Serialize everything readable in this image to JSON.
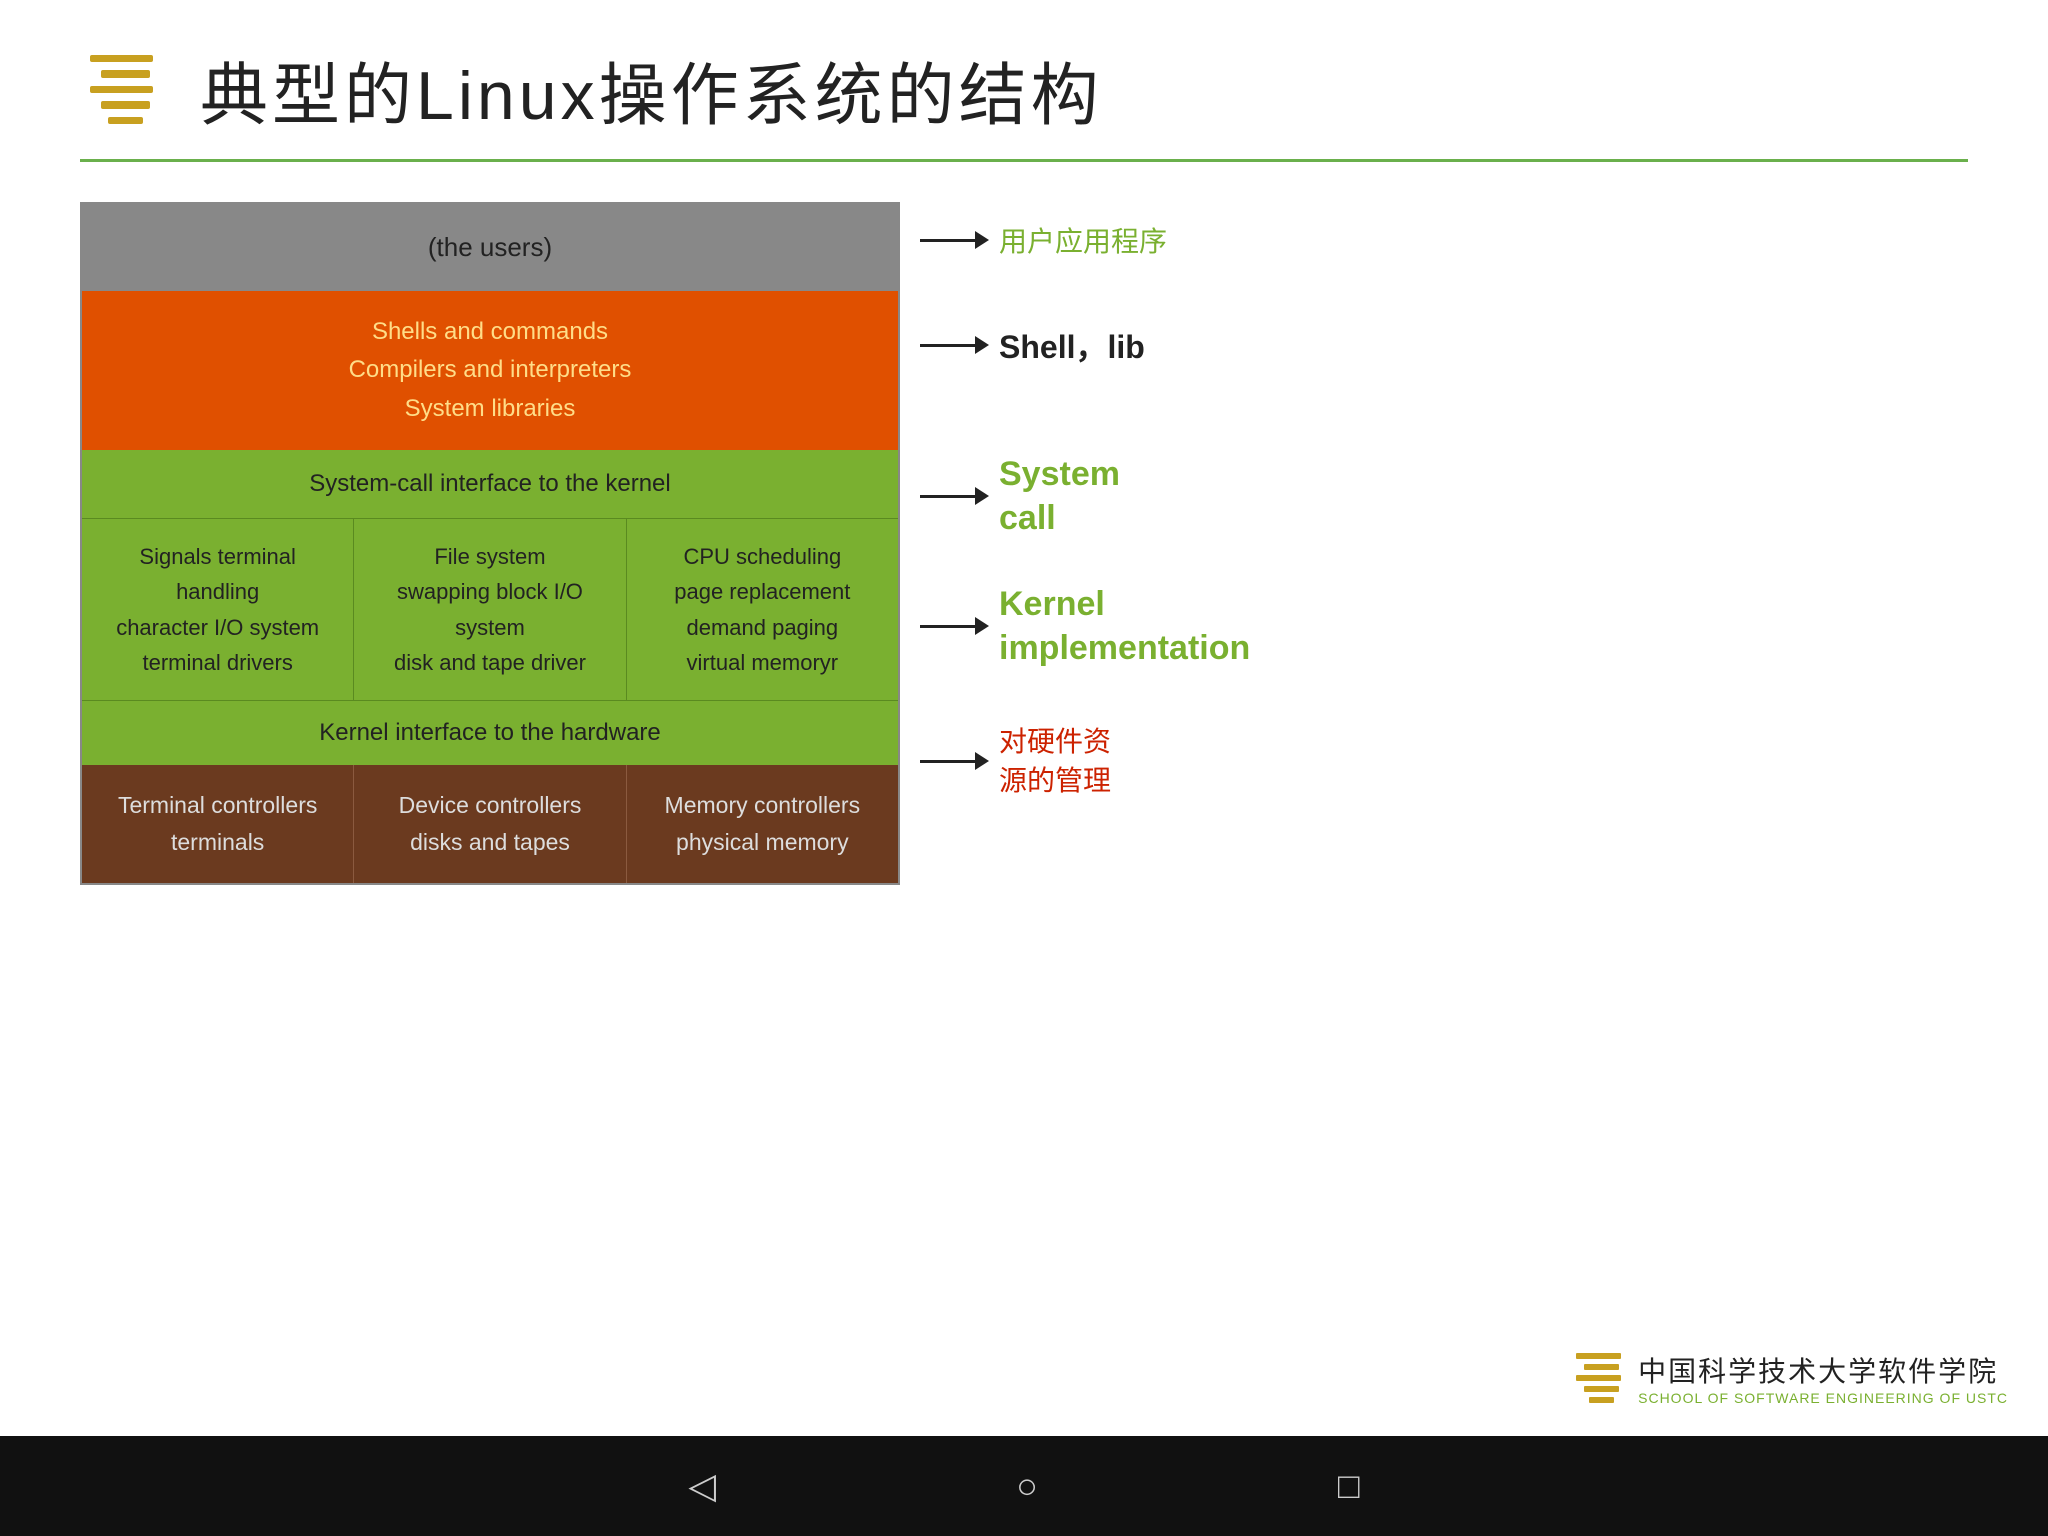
{
  "title": "典型的Linux操作系统的结构",
  "diagram": {
    "users_layer": "(the users)",
    "orange_layer": {
      "line1": "Shells and commands",
      "line2": "Compilers and interpreters",
      "line3": "System libraries"
    },
    "syscall_layer": "System-call interface to the kernel",
    "kernel_cells": [
      {
        "line1": "Signals terminal",
        "line2": "handling",
        "line3": "character I/O system",
        "line4": "terminal    drivers"
      },
      {
        "line1": "File system",
        "line2": "swapping block I/O",
        "line3": "system",
        "line4": "disk and tape driver"
      },
      {
        "line1": "CPU scheduling",
        "line2": "page replacement",
        "line3": "demand paging",
        "line4": "virtual memoryr"
      }
    ],
    "hw_interface": "Kernel interface to the hardware",
    "ctrl_cells": [
      {
        "line1": "Terminal controllers",
        "line2": "terminals"
      },
      {
        "line1": "Device controllers",
        "line2": "disks and tapes"
      },
      {
        "line1": "Memory controllers",
        "line2": "physical memory"
      }
    ]
  },
  "annotations": {
    "users": "用户应用程序",
    "shell_lib": "Shell，lib",
    "system_call_line1": "System",
    "system_call_line2": "call",
    "kernel_line1": "Kernel",
    "kernel_line2": "implementation",
    "hw_line1": "对硬件资",
    "hw_line2": "源的管理"
  },
  "school": {
    "name_cn": "中国科学技术大学软件学院",
    "name_en": "SCHOOL OF SOFTWARE ENGINEERING OF USTC"
  },
  "nav": {
    "back": "◁",
    "home": "○",
    "recent": "□"
  }
}
